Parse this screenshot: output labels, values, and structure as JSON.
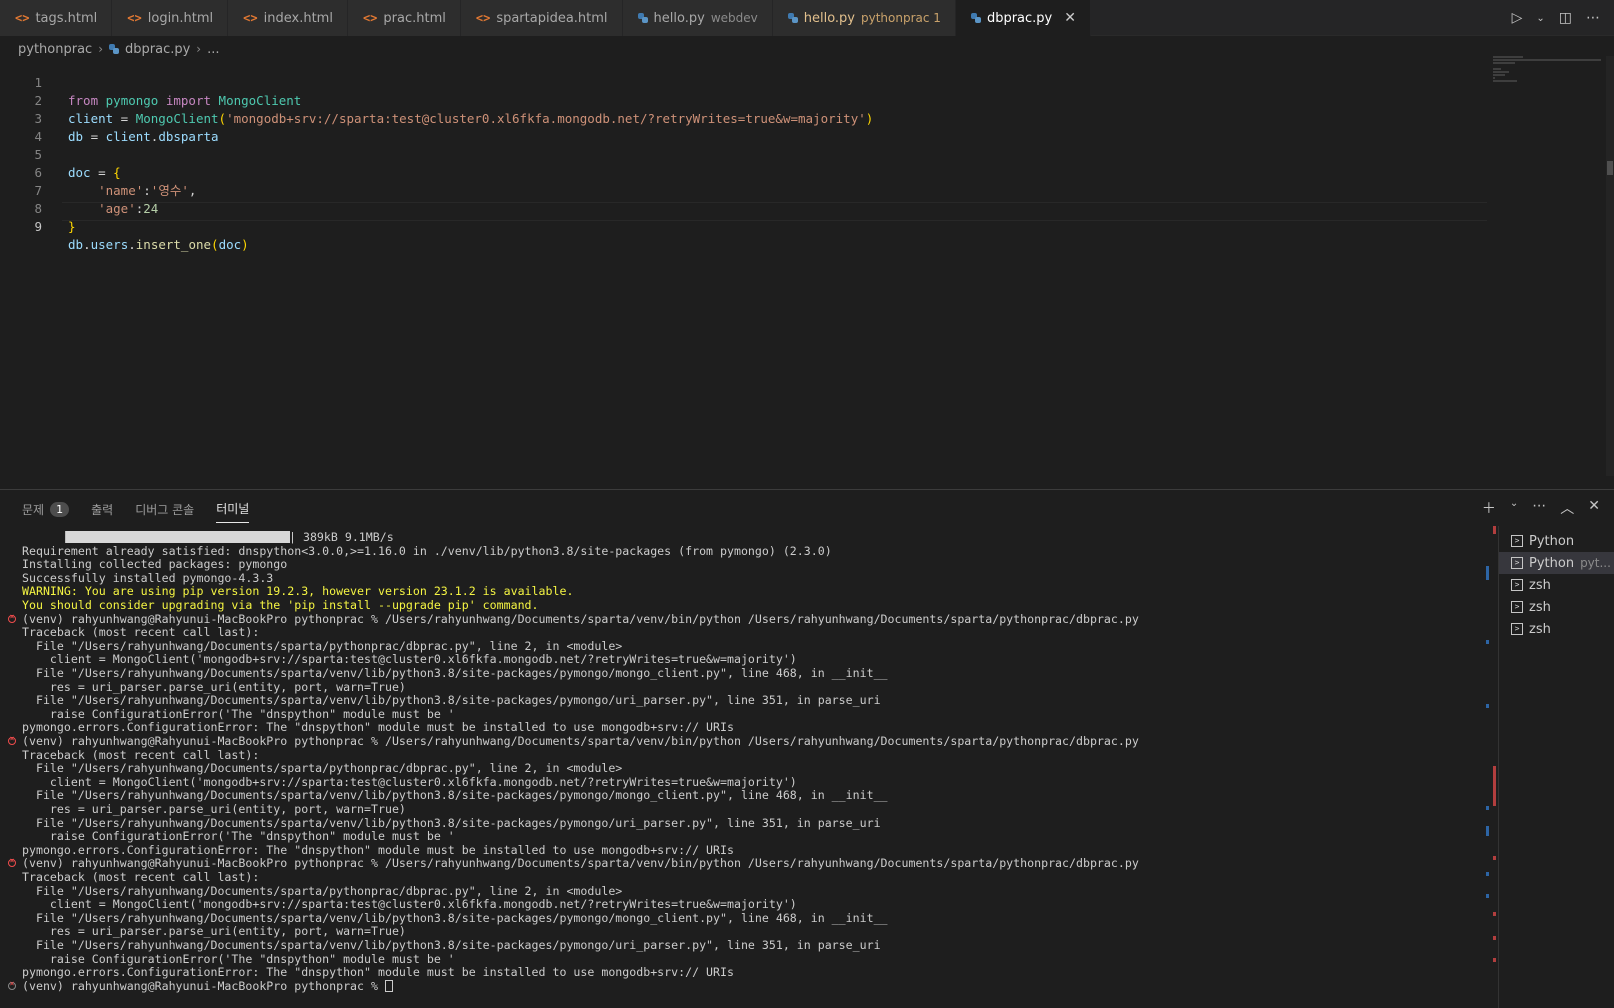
{
  "tabs": [
    {
      "label": "tags.html",
      "desc": "",
      "type": "html"
    },
    {
      "label": "login.html",
      "desc": "",
      "type": "html"
    },
    {
      "label": "index.html",
      "desc": "",
      "type": "html"
    },
    {
      "label": "prac.html",
      "desc": "",
      "type": "html"
    },
    {
      "label": "spartapidea.html",
      "desc": "",
      "type": "html"
    },
    {
      "label": "hello.py",
      "desc": "webdev",
      "type": "py"
    },
    {
      "label": "hello.py",
      "desc": "pythonprac 1",
      "type": "py"
    },
    {
      "label": "dbprac.py",
      "desc": "",
      "type": "py"
    }
  ],
  "breadcrumb": {
    "folder": "pythonprac",
    "file": "dbprac.py",
    "more": "..."
  },
  "editor": {
    "line_numbers": [
      "1",
      "2",
      "3",
      "4",
      "5",
      "6",
      "7",
      "8",
      "9"
    ],
    "lines": [
      "from pymongo import MongoClient",
      "client = MongoClient('mongodb+srv://sparta:test@cluster0.xl6fkfa.mongodb.net/?retryWrites=true&w=majority')",
      "db = client.dbsparta",
      "",
      "doc = {",
      "    'name':'영수',",
      "    'age':24",
      "}",
      "db.users.insert_one(doc)"
    ]
  },
  "panel": {
    "tabs": [
      {
        "label": "문제",
        "badge": "1"
      },
      {
        "label": "출력",
        "badge": ""
      },
      {
        "label": "디버그 콘솔",
        "badge": ""
      },
      {
        "label": "터미널",
        "badge": ""
      }
    ],
    "terminal_lines": [
      {
        "text": "| 389kB 9.1MB/s",
        "kind": "progress"
      },
      {
        "text": "Requirement already satisfied: dnspython<3.0.0,>=1.16.0 in ./venv/lib/python3.8/site-packages (from pymongo) (2.3.0)",
        "kind": "normal"
      },
      {
        "text": "Installing collected packages: pymongo",
        "kind": "normal"
      },
      {
        "text": "Successfully installed pymongo-4.3.3",
        "kind": "normal"
      },
      {
        "text": "WARNING: You are using pip version 19.2.3, however version 23.1.2 is available.",
        "kind": "warn"
      },
      {
        "text": "You should consider upgrading via the 'pip install --upgrade pip' command.",
        "kind": "warn"
      },
      {
        "text": "(venv) rahyunhwang@Rahyunui-MacBookPro pythonprac % /Users/rahyunhwang/Documents/sparta/venv/bin/python /Users/rahyunhwang/Documents/sparta/pythonprac/dbprac.py",
        "kind": "error-prompt"
      },
      {
        "text": "Traceback (most recent call last):",
        "kind": "normal"
      },
      {
        "text": "  File \"/Users/rahyunhwang/Documents/sparta/pythonprac/dbprac.py\", line 2, in <module>",
        "kind": "normal"
      },
      {
        "text": "    client = MongoClient('mongodb+srv://sparta:test@cluster0.xl6fkfa.mongodb.net/?retryWrites=true&w=majority')",
        "kind": "normal"
      },
      {
        "text": "  File \"/Users/rahyunhwang/Documents/sparta/venv/lib/python3.8/site-packages/pymongo/mongo_client.py\", line 468, in __init__",
        "kind": "normal"
      },
      {
        "text": "    res = uri_parser.parse_uri(entity, port, warn=True)",
        "kind": "normal"
      },
      {
        "text": "  File \"/Users/rahyunhwang/Documents/sparta/venv/lib/python3.8/site-packages/pymongo/uri_parser.py\", line 351, in parse_uri",
        "kind": "normal"
      },
      {
        "text": "    raise ConfigurationError('The \"dnspython\" module must be '",
        "kind": "normal"
      },
      {
        "text": "pymongo.errors.ConfigurationError: The \"dnspython\" module must be installed to use mongodb+srv:// URIs",
        "kind": "normal"
      },
      {
        "text": "(venv) rahyunhwang@Rahyunui-MacBookPro pythonprac % /Users/rahyunhwang/Documents/sparta/venv/bin/python /Users/rahyunhwang/Documents/sparta/pythonprac/dbprac.py",
        "kind": "error-prompt"
      },
      {
        "text": "Traceback (most recent call last):",
        "kind": "normal"
      },
      {
        "text": "  File \"/Users/rahyunhwang/Documents/sparta/pythonprac/dbprac.py\", line 2, in <module>",
        "kind": "normal"
      },
      {
        "text": "    client = MongoClient('mongodb+srv://sparta:test@cluster0.xl6fkfa.mongodb.net/?retryWrites=true&w=majority')",
        "kind": "normal"
      },
      {
        "text": "  File \"/Users/rahyunhwang/Documents/sparta/venv/lib/python3.8/site-packages/pymongo/mongo_client.py\", line 468, in __init__",
        "kind": "normal"
      },
      {
        "text": "    res = uri_parser.parse_uri(entity, port, warn=True)",
        "kind": "normal"
      },
      {
        "text": "  File \"/Users/rahyunhwang/Documents/sparta/venv/lib/python3.8/site-packages/pymongo/uri_parser.py\", line 351, in parse_uri",
        "kind": "normal"
      },
      {
        "text": "    raise ConfigurationError('The \"dnspython\" module must be '",
        "kind": "normal"
      },
      {
        "text": "pymongo.errors.ConfigurationError: The \"dnspython\" module must be installed to use mongodb+srv:// URIs",
        "kind": "normal"
      },
      {
        "text": "(venv) rahyunhwang@Rahyunui-MacBookPro pythonprac % /Users/rahyunhwang/Documents/sparta/venv/bin/python /Users/rahyunhwang/Documents/sparta/pythonprac/dbprac.py",
        "kind": "error-prompt"
      },
      {
        "text": "Traceback (most recent call last):",
        "kind": "normal"
      },
      {
        "text": "  File \"/Users/rahyunhwang/Documents/sparta/pythonprac/dbprac.py\", line 2, in <module>",
        "kind": "normal"
      },
      {
        "text": "    client = MongoClient('mongodb+srv://sparta:test@cluster0.xl6fkfa.mongodb.net/?retryWrites=true&w=majority')",
        "kind": "normal"
      },
      {
        "text": "  File \"/Users/rahyunhwang/Documents/sparta/venv/lib/python3.8/site-packages/pymongo/mongo_client.py\", line 468, in __init__",
        "kind": "normal"
      },
      {
        "text": "    res = uri_parser.parse_uri(entity, port, warn=True)",
        "kind": "normal"
      },
      {
        "text": "  File \"/Users/rahyunhwang/Documents/sparta/venv/lib/python3.8/site-packages/pymongo/uri_parser.py\", line 351, in parse_uri",
        "kind": "normal"
      },
      {
        "text": "    raise ConfigurationError('The \"dnspython\" module must be '",
        "kind": "normal"
      },
      {
        "text": "pymongo.errors.ConfigurationError: The \"dnspython\" module must be installed to use mongodb+srv:// URIs",
        "kind": "normal"
      },
      {
        "text": "(venv) rahyunhwang@Rahyunui-MacBookPro pythonprac % ",
        "kind": "prompt-cursor"
      }
    ],
    "terminal_list": [
      {
        "label": "Python",
        "desc": ""
      },
      {
        "label": "Python",
        "desc": "pyt..."
      },
      {
        "label": "zsh",
        "desc": ""
      },
      {
        "label": "zsh",
        "desc": ""
      },
      {
        "label": "zsh",
        "desc": ""
      }
    ]
  },
  "colors": {
    "background": "#1e1e1e",
    "tab_bar": "#252526",
    "warning_text": "#f5f543",
    "error": "#f14c4c",
    "modified_tab": "#e2c08d"
  }
}
